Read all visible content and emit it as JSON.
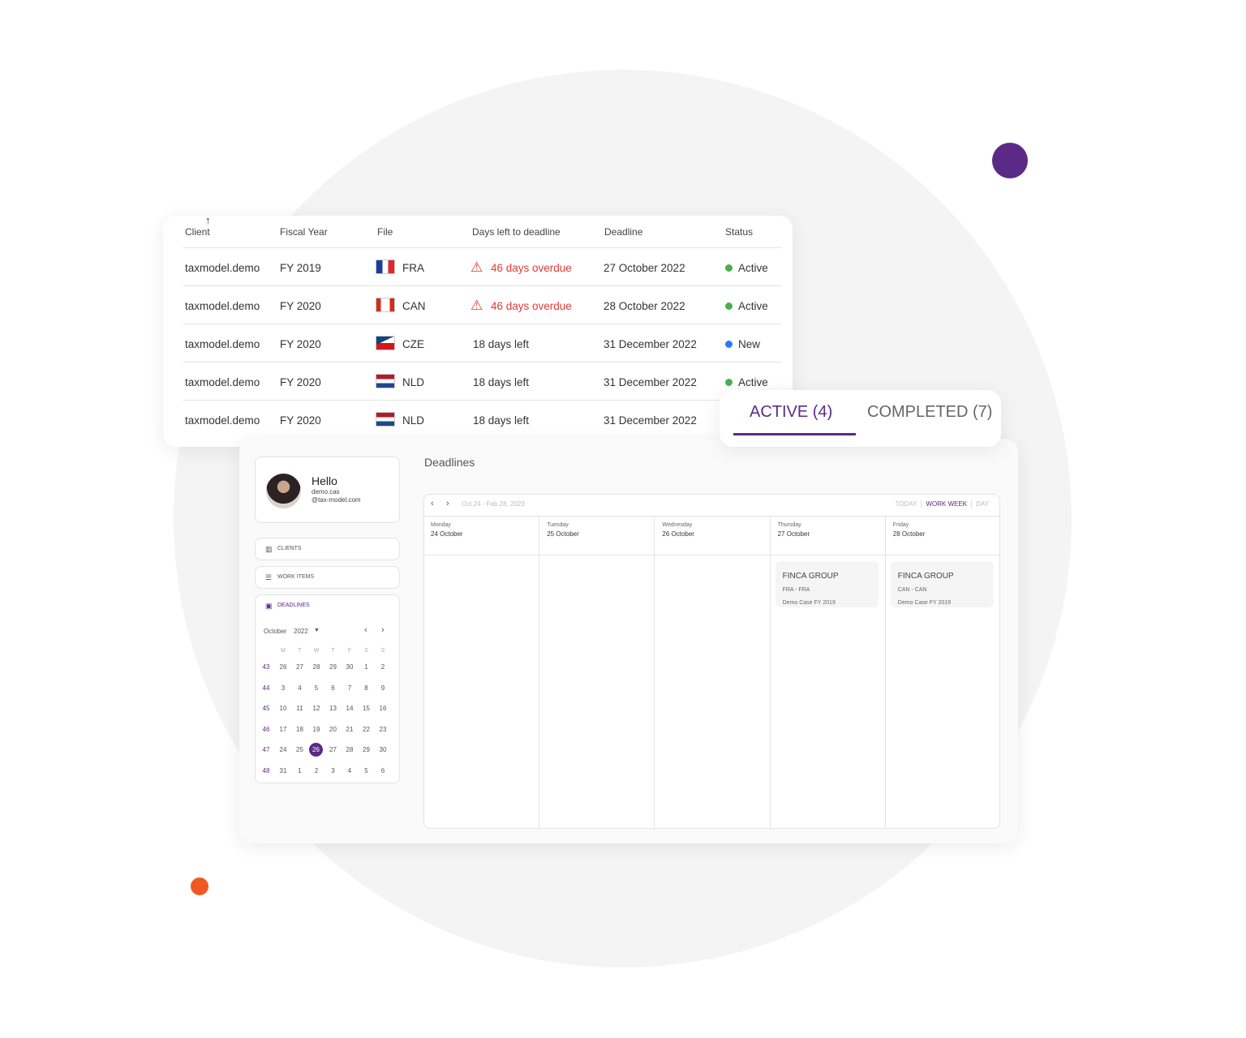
{
  "colors": {
    "accent": "#5b2a86",
    "overdue": "#e53935",
    "active": "#4caf50",
    "new": "#2979ff",
    "orange": "#f05a22"
  },
  "table": {
    "headers": [
      "Client",
      "Fiscal Year",
      "File",
      "Days left to deadline",
      "Deadline",
      "Status"
    ],
    "sort_icon": "arrow-up-icon",
    "rows": [
      {
        "client": "taxmodel.demo",
        "fy": "FY 2019",
        "file": "FRA",
        "days": "46 days overdue",
        "overdue": true,
        "deadline": "27 October 2022",
        "status": "Active"
      },
      {
        "client": "taxmodel.demo",
        "fy": "FY 2020",
        "file": "CAN",
        "days": "46 days overdue",
        "overdue": true,
        "deadline": "28 October 2022",
        "status": "Active"
      },
      {
        "client": "taxmodel.demo",
        "fy": "FY 2020",
        "file": "CZE",
        "days": "18 days left",
        "overdue": false,
        "deadline": "31 December 2022",
        "status": "New"
      },
      {
        "client": "taxmodel.demo",
        "fy": "FY 2020",
        "file": "NLD",
        "days": "18 days left",
        "overdue": false,
        "deadline": "31 December 2022",
        "status": "Active"
      },
      {
        "client": "taxmodel.demo",
        "fy": "FY 2020",
        "file": "NLD",
        "days": "18 days left",
        "overdue": false,
        "deadline": "31 December 2022",
        "status": ""
      }
    ]
  },
  "tabs": {
    "active": "ACTIVE (4)",
    "completed": "COMPLETED (7)"
  },
  "profile": {
    "greeting": "Hello",
    "user_line1": "demo.cas",
    "user_line2": "@tax-model.com"
  },
  "nav": {
    "clients": "CLIENTS",
    "work_items": "WORK ITEMS",
    "deadlines": "DEADLINES"
  },
  "mini_calendar": {
    "month": "October",
    "year": "2022",
    "weekdays": [
      "M",
      "T",
      "W",
      "T",
      "F",
      "S",
      "S"
    ],
    "weeks": [
      {
        "num": "43",
        "days": [
          "26",
          "27",
          "28",
          "29",
          "30",
          "1",
          "2"
        ]
      },
      {
        "num": "44",
        "days": [
          "3",
          "4",
          "5",
          "6",
          "7",
          "8",
          "9"
        ]
      },
      {
        "num": "45",
        "days": [
          "10",
          "11",
          "12",
          "13",
          "14",
          "15",
          "16"
        ]
      },
      {
        "num": "46",
        "days": [
          "17",
          "18",
          "19",
          "20",
          "21",
          "22",
          "23"
        ]
      },
      {
        "num": "47",
        "days": [
          "24",
          "25",
          "26",
          "27",
          "28",
          "29",
          "30"
        ]
      },
      {
        "num": "48",
        "days": [
          "31",
          "1",
          "2",
          "3",
          "4",
          "5",
          "6"
        ]
      }
    ],
    "selected": "26"
  },
  "deadlines": {
    "title": "Deadlines",
    "range": "Oct 24 - Feb 28, 2023",
    "views": [
      "TODAY",
      "WORK WEEK",
      "DAY"
    ],
    "selected_view": "WORK WEEK",
    "days": [
      {
        "name": "Monday",
        "date": "24 October"
      },
      {
        "name": "Tuesday",
        "date": "25 October"
      },
      {
        "name": "Wednesday",
        "date": "26 October"
      },
      {
        "name": "Thursday",
        "date": "27 October"
      },
      {
        "name": "Friday",
        "date": "28 October"
      }
    ],
    "events": [
      {
        "day": 3,
        "title": "FINCA GROUP",
        "sub": "FRA - FRA",
        "case": "Demo Case FY 2019"
      },
      {
        "day": 4,
        "title": "FINCA GROUP",
        "sub": "CAN - CAN",
        "case": "Demo Case FY 2019"
      }
    ]
  }
}
